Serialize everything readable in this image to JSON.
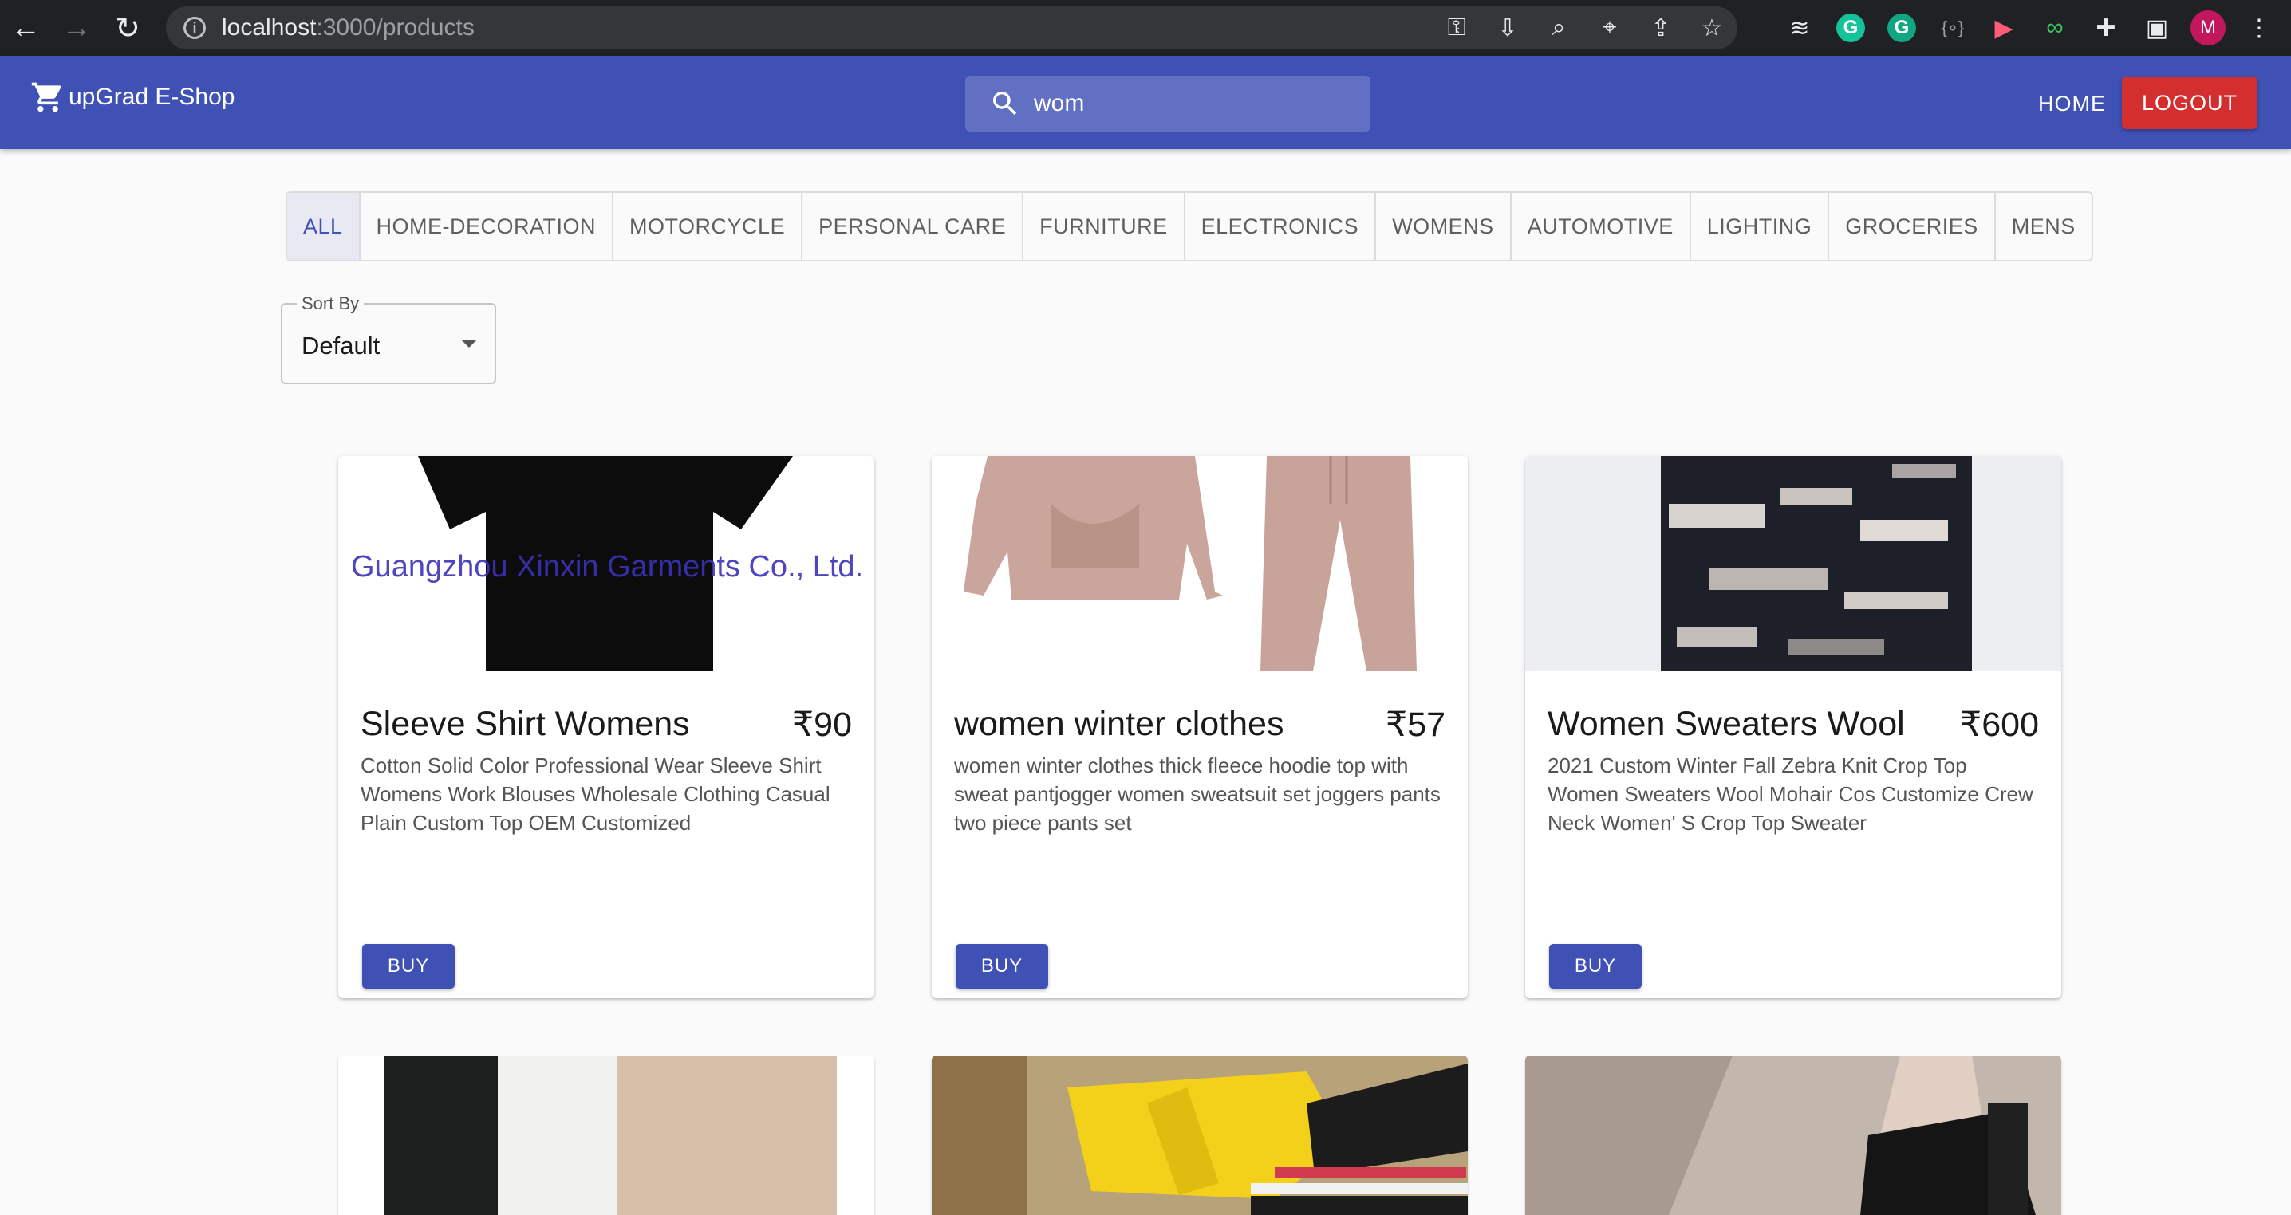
{
  "browser": {
    "url_host": "localhost",
    "url_path": ":3000/products",
    "profile_initial": "M"
  },
  "appbar": {
    "brand": "upGrad E-Shop",
    "search_value": "wom",
    "search_placeholder": "Search…",
    "home_label": "HOME",
    "logout_label": "LOGOUT",
    "primary_color": "#3f51b5",
    "logout_color": "#d32f2f"
  },
  "categories": [
    "ALL",
    "HOME-DECORATION",
    "MOTORCYCLE",
    "PERSONAL CARE",
    "FURNITURE",
    "ELECTRONICS",
    "WOMENS",
    "AUTOMOTIVE",
    "LIGHTING",
    "GROCERIES",
    "MENS"
  ],
  "selected_category": "ALL",
  "sort": {
    "label": "Sort By",
    "value": "Default"
  },
  "products": [
    {
      "name": "Sleeve Shirt Womens",
      "price": "₹90",
      "description": "Cotton Solid Color Professional Wear Sleeve Shirt Womens Work Blouses Wholesale Clothing Casual Plain Custom Top OEM Customized",
      "buy_label": "BUY",
      "image_watermark": "Guangzhou Xinxin Garments Co., Ltd."
    },
    {
      "name": "women winter clothes",
      "price": "₹57",
      "description": "women winter clothes thick fleece hoodie top with sweat pantjogger women sweatsuit set joggers pants two piece pants set",
      "buy_label": "BUY"
    },
    {
      "name": "Women Sweaters Wool",
      "price": "₹600",
      "description": "2021 Custom Winter Fall Zebra Knit Crop Top Women Sweaters Wool Mohair Cos Customize Crew Neck Women' S Crop Top Sweater",
      "buy_label": "BUY"
    }
  ]
}
